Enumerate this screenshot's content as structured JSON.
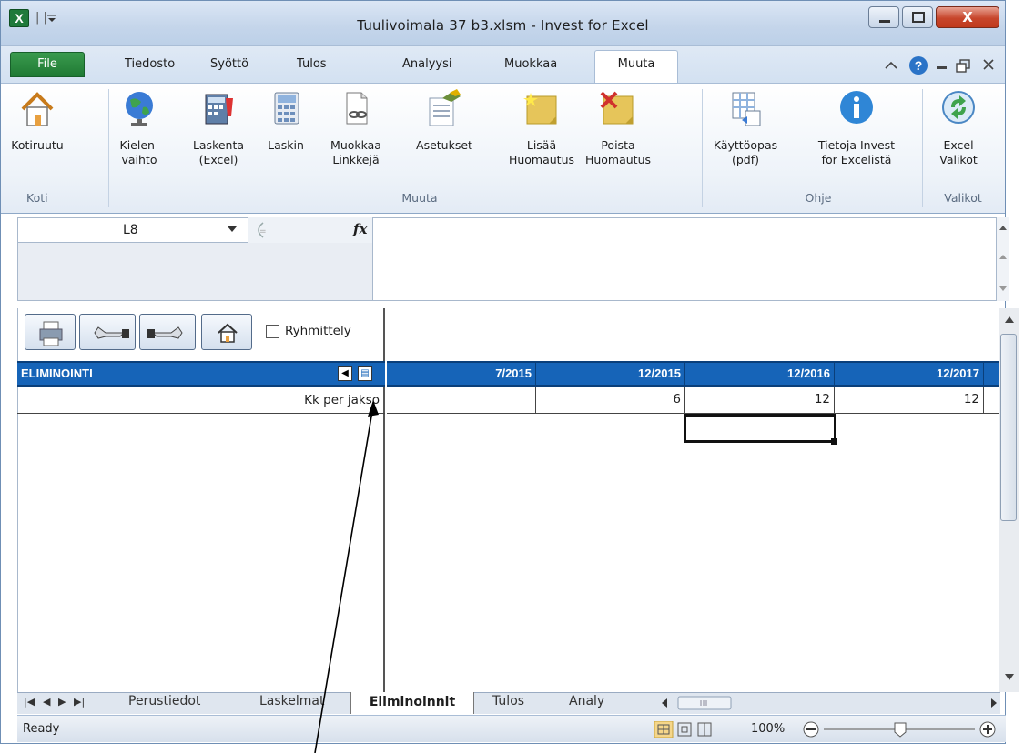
{
  "window": {
    "title": "Tuulivoimala 37 b3.xlsm  -  Invest for Excel",
    "app_icon": "excel-icon"
  },
  "ribbon_tabs": {
    "file": "File",
    "tabs": [
      "Tiedosto",
      "Syöttö",
      "Tulos",
      "Analyysi",
      "Muokkaa"
    ],
    "active": "Muuta"
  },
  "ribbon": {
    "koti": {
      "kotiruutu": "Kotiruutu",
      "group": "Koti"
    },
    "muuta": {
      "kielen_1": "Kielen-",
      "kielen_2": "vaihto",
      "laskenta_1": "Laskenta",
      "laskenta_2": "(Excel)",
      "laskin": "Laskin",
      "muokkaa_1": "Muokkaa",
      "muokkaa_2": "Linkkejä",
      "asetukset": "Asetukset",
      "lisaa_1": "Lisää",
      "lisaa_2": "Huomautus",
      "poista_1": "Poista",
      "poista_2": "Huomautus",
      "group": "Muuta"
    },
    "ohje": {
      "kaytto_1": "Käyttöopas",
      "kaytto_2": "(pdf)",
      "tietoja_1": "Tietoja Invest",
      "tietoja_2": "for Excelistä",
      "group": "Ohje"
    },
    "valikot": {
      "excel_1": "Excel",
      "excel_2": "Valikot",
      "group": "Valikot"
    }
  },
  "formula_bar": {
    "name_box": "L8",
    "fx": "fx",
    "formula": ""
  },
  "toolbar": {
    "grouping_label": "Ryhmittely",
    "grouping_checked": false
  },
  "sheet": {
    "header_title": "ELIMINOINTI",
    "periods": [
      "7/2015",
      "12/2015",
      "12/2016",
      "12/2017"
    ],
    "row_label": "Kk per jakso",
    "row_values": [
      "",
      "6",
      "12",
      "12"
    ]
  },
  "sheet_tabs": {
    "tabs": [
      "Perustiedot",
      "Laskelmat",
      "Eliminoinnit",
      "Tulos",
      "Analy"
    ],
    "active": "Eliminoinnit"
  },
  "status": {
    "ready": "Ready",
    "zoom": "100%"
  },
  "colors": {
    "header_blue": "#1664b8",
    "file_green": "#1f7a34",
    "close_red": "#c7462c"
  }
}
